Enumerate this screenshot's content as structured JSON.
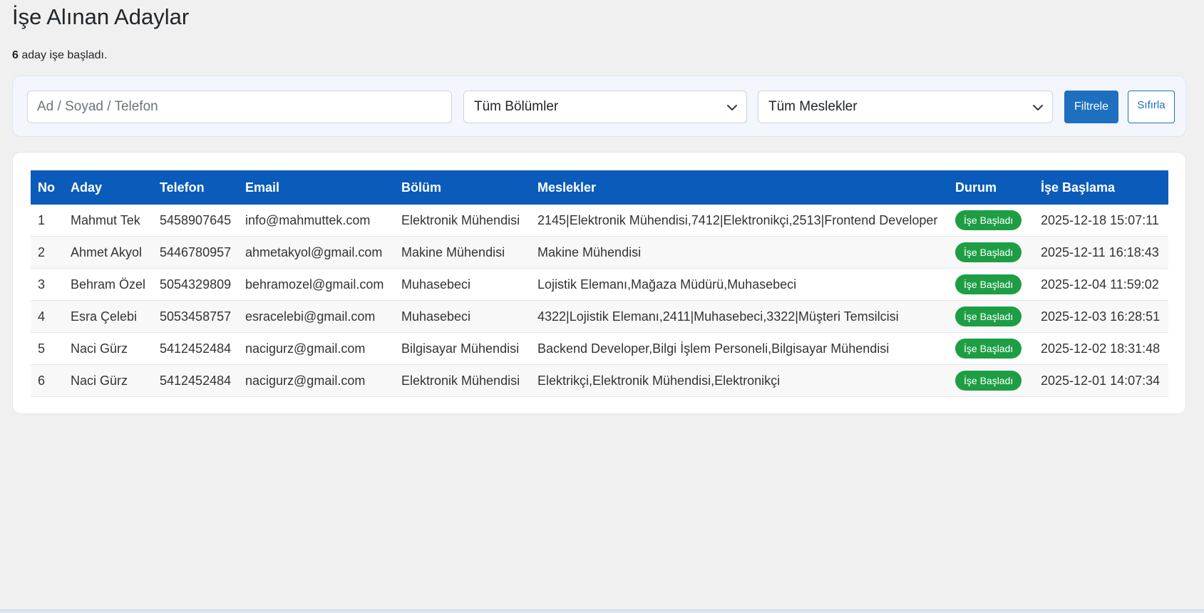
{
  "page": {
    "title": "İşe Alınan Adaylar",
    "summary_count": "6",
    "summary_text": " aday işe başladı."
  },
  "filters": {
    "search_placeholder": "Ad / Soyad / Telefon",
    "search_value": "",
    "bolum_selected": "Tüm Bölümler",
    "meslek_selected": "Tüm Meslekler",
    "filter_label": "Filtrele",
    "reset_label": "Sıfırla"
  },
  "colors": {
    "header_bg": "#0b5cba",
    "primary": "#1f6fc1",
    "badge_green": "#1e9e44"
  },
  "table": {
    "headers": [
      "No",
      "Aday",
      "Telefon",
      "Email",
      "Bölüm",
      "Meslekler",
      "Durum",
      "İşe Başlama"
    ],
    "rows": [
      {
        "no": "1",
        "aday": "Mahmut Tek",
        "telefon": "5458907645",
        "email": "info@mahmuttek.com",
        "bolum": "Elektronik Mühendisi",
        "meslekler": "2145|Elektronik Mühendisi,7412|Elektronikçi,2513|Frontend Developer",
        "durum": "İşe Başladı",
        "baslama": "2025-12-18 15:07:11"
      },
      {
        "no": "2",
        "aday": "Ahmet Akyol",
        "telefon": "5446780957",
        "email": "ahmetakyol@gmail.com",
        "bolum": "Makine Mühendisi",
        "meslekler": "Makine Mühendisi",
        "durum": "İşe Başladı",
        "baslama": "2025-12-11 16:18:43"
      },
      {
        "no": "3",
        "aday": "Behram Özel",
        "telefon": "5054329809",
        "email": "behramozel@gmail.com",
        "bolum": "Muhasebeci",
        "meslekler": "Lojistik Elemanı,Mağaza Müdürü,Muhasebeci",
        "durum": "İşe Başladı",
        "baslama": "2025-12-04 11:59:02"
      },
      {
        "no": "4",
        "aday": "Esra Çelebi",
        "telefon": "5053458757",
        "email": "esracelebi@gmail.com",
        "bolum": "Muhasebeci",
        "meslekler": "4322|Lojistik Elemanı,2411|Muhasebeci,3322|Müşteri Temsilcisi",
        "durum": "İşe Başladı",
        "baslama": "2025-12-03 16:28:51"
      },
      {
        "no": "5",
        "aday": "Naci Gürz",
        "telefon": "5412452484",
        "email": "nacigurz@gmail.com",
        "bolum": "Bilgisayar Mühendisi",
        "meslekler": "Backend Developer,Bilgi İşlem Personeli,Bilgisayar Mühendisi",
        "durum": "İşe Başladı",
        "baslama": "2025-12-02 18:31:48"
      },
      {
        "no": "6",
        "aday": "Naci Gürz",
        "telefon": "5412452484",
        "email": "nacigurz@gmail.com",
        "bolum": "Elektronik Mühendisi",
        "meslekler": "Elektrikçi,Elektronik Mühendisi,Elektronikçi",
        "durum": "İşe Başladı",
        "baslama": "2025-12-01 14:07:34"
      }
    ]
  }
}
